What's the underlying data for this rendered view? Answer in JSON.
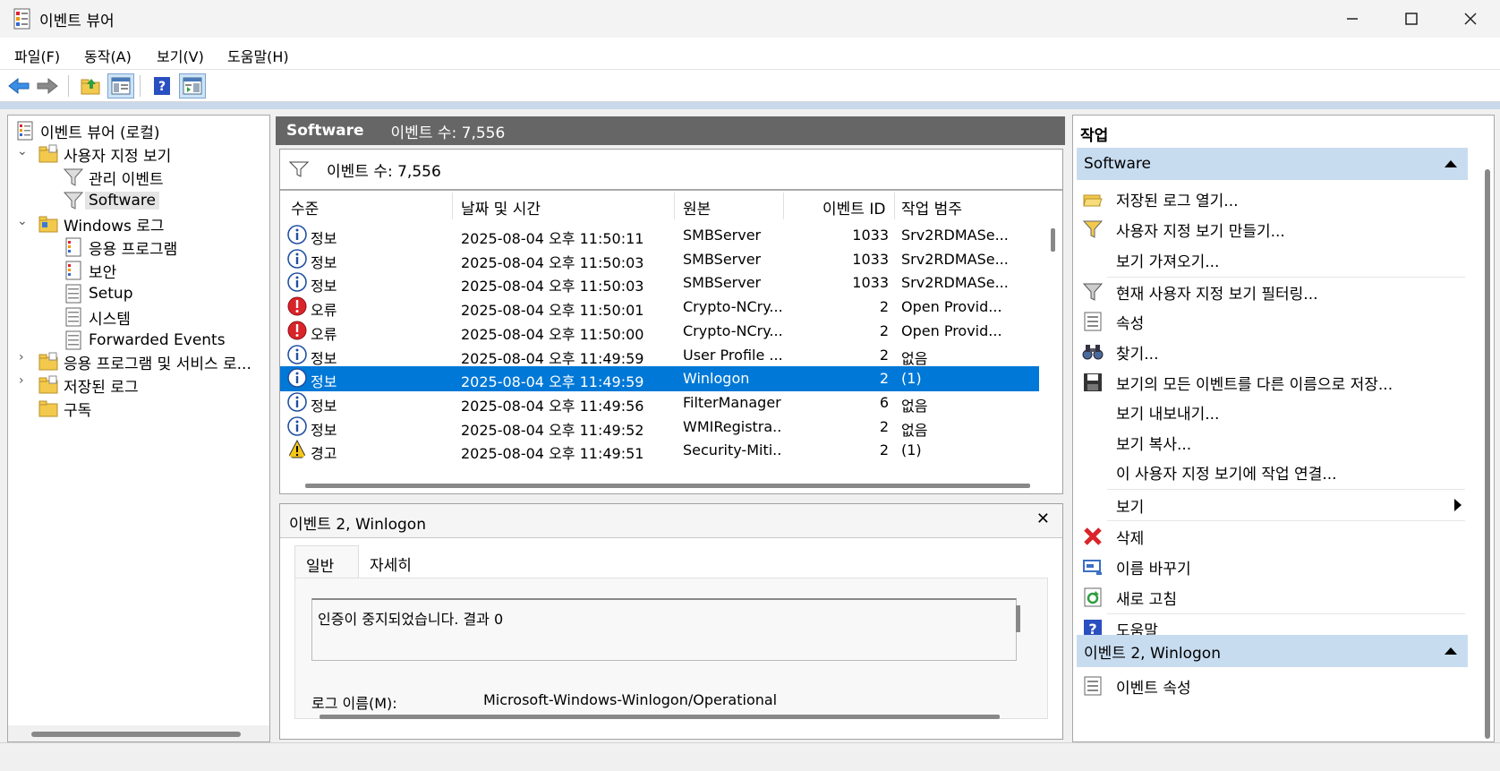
{
  "window": {
    "title": "이벤트 뷰어",
    "minimize": "—",
    "maximize": "☐",
    "close": "✕"
  },
  "menu": [
    "파일(F)",
    "동작(A)",
    "보기(V)",
    "도움말(H)"
  ],
  "toolbar": {
    "back": "back-icon",
    "forward": "forward-icon",
    "up": "folder-up-icon",
    "show_hide_tree": "console-tree-icon",
    "help": "help-icon",
    "show_hide_action": "action-pane-icon"
  },
  "tree": {
    "root": "이벤트 뷰어 (로컬)",
    "custom_views": "사용자 지정 보기",
    "admin_events": "관리 이벤트",
    "software": "Software",
    "windows_logs": "Windows 로그",
    "application": "응용 프로그램",
    "security": "보안",
    "setup": "Setup",
    "system": "시스템",
    "forwarded": "Forwarded Events",
    "app_services": "응용 프로그램 및 서비스 로...",
    "saved_logs": "저장된 로그",
    "subscriptions": "구독"
  },
  "center": {
    "view_name": "Software",
    "event_count": "이벤트 수: 7,556",
    "filter_text": "이벤트 수: 7,556"
  },
  "columns": [
    "수준",
    "날짜 및 시간",
    "원본",
    "이벤트 ID",
    "작업 범주"
  ],
  "rows": [
    {
      "level": "정보",
      "type": "info",
      "datetime": "2025-08-04 오후 11:50:11",
      "source": "SMBServer",
      "id": "1033",
      "category": "Srv2RDMASe..."
    },
    {
      "level": "정보",
      "type": "info",
      "datetime": "2025-08-04 오후 11:50:03",
      "source": "SMBServer",
      "id": "1033",
      "category": "Srv2RDMASe..."
    },
    {
      "level": "정보",
      "type": "info",
      "datetime": "2025-08-04 오후 11:50:03",
      "source": "SMBServer",
      "id": "1033",
      "category": "Srv2RDMASe..."
    },
    {
      "level": "오류",
      "type": "error",
      "datetime": "2025-08-04 오후 11:50:01",
      "source": "Crypto-NCry...",
      "id": "2",
      "category": "Open Provid..."
    },
    {
      "level": "오류",
      "type": "error",
      "datetime": "2025-08-04 오후 11:50:00",
      "source": "Crypto-NCry...",
      "id": "2",
      "category": "Open Provid..."
    },
    {
      "level": "정보",
      "type": "info",
      "datetime": "2025-08-04 오후 11:49:59",
      "source": "User Profile ...",
      "id": "2",
      "category": "없음"
    },
    {
      "level": "정보",
      "type": "info",
      "datetime": "2025-08-04 오후 11:49:59",
      "source": "Winlogon",
      "id": "2",
      "category": "(1)",
      "selected": true
    },
    {
      "level": "정보",
      "type": "info",
      "datetime": "2025-08-04 오후 11:49:56",
      "source": "FilterManager",
      "id": "6",
      "category": "없음"
    },
    {
      "level": "정보",
      "type": "info",
      "datetime": "2025-08-04 오후 11:49:52",
      "source": "WMIRegistra...",
      "id": "2",
      "category": "없음"
    },
    {
      "level": "경고",
      "type": "warning",
      "datetime": "2025-08-04 오후 11:49:51",
      "source": "Security-Miti...",
      "id": "2",
      "category": "(1)"
    }
  ],
  "detail": {
    "title": "이벤트 2, Winlogon",
    "close": "✕",
    "tab_general": "일반",
    "tab_details": "자세히",
    "description": "인증이 중지되었습니다. 결과 0",
    "log_name_label": "로그 이름(M):",
    "log_name_value": "Microsoft-Windows-Winlogon/Operational"
  },
  "actions": {
    "header": "작업",
    "section1": "Software",
    "open_saved": "저장된 로그 열기...",
    "create_custom": "사용자 지정 보기 만들기...",
    "import_view": "보기 가져오기...",
    "filter_current": "현재 사용자 지정 보기 필터링...",
    "properties": "속성",
    "find": "찾기...",
    "save_all": "보기의 모든 이벤트를 다른 이름으로 저장...",
    "export_view": "보기 내보내기...",
    "copy_view": "보기 복사...",
    "attach_task": "이 사용자 지정 보기에 작업 연결...",
    "view": "보기",
    "delete": "삭제",
    "rename": "이름 바꾸기",
    "refresh": "새로 고침",
    "help": "도움말",
    "section2": "이벤트 2, Winlogon",
    "event_props": "이벤트 속성"
  },
  "colors": {
    "selection": "#0078d7",
    "section_bg": "#c8dcf0",
    "header_bg": "#666666"
  }
}
